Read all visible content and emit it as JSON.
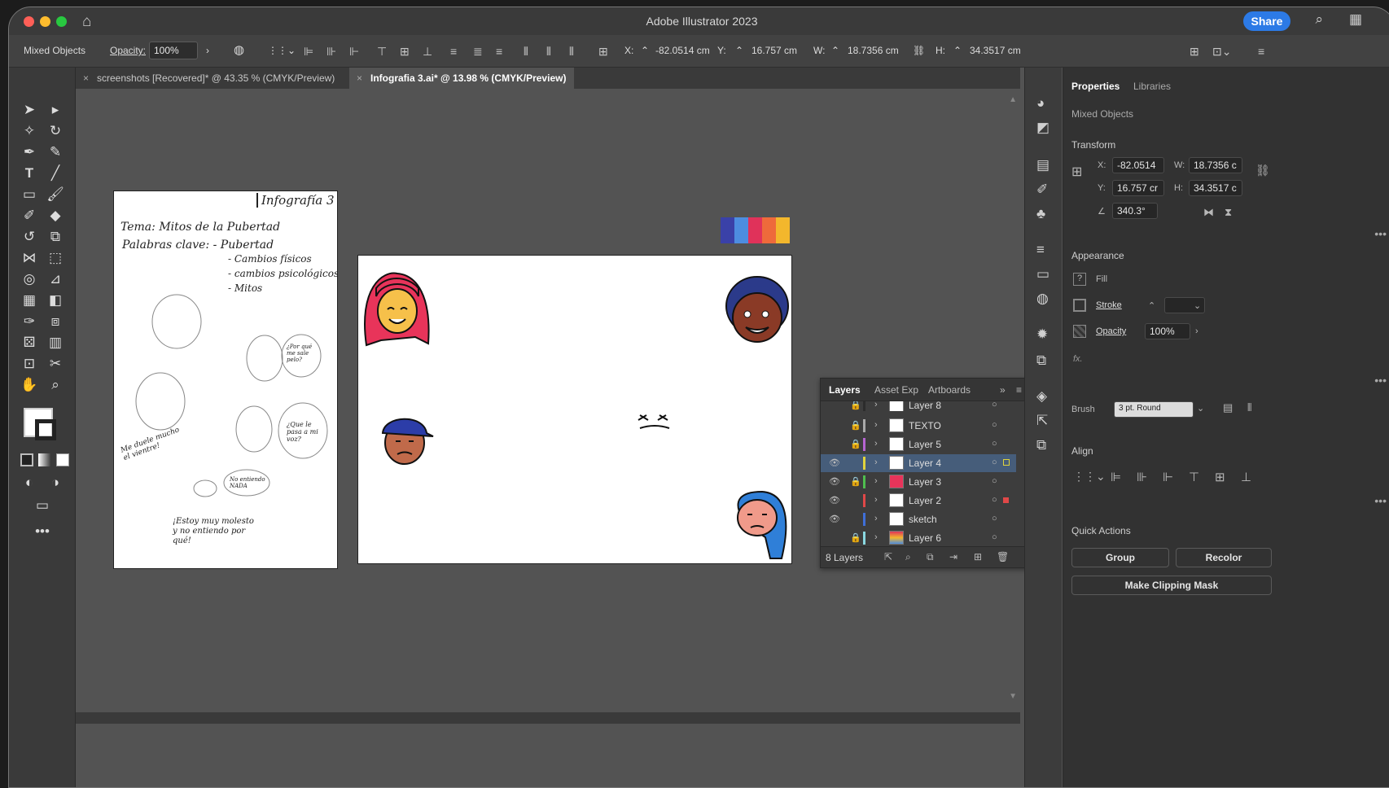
{
  "app": {
    "title": "Adobe Illustrator 2023",
    "share_label": "Share"
  },
  "control_bar": {
    "selection_type": "Mixed Objects",
    "opacity_label": "Opacity:",
    "opacity_value": "100%",
    "x_label": "X:",
    "x_value": "-82.0514 cm",
    "y_label": "Y:",
    "y_value": "16.757 cm",
    "w_label": "W:",
    "w_value": "18.7356 cm",
    "h_label": "H:",
    "h_value": "34.3517 cm"
  },
  "tabs": [
    {
      "label": "screenshots [Recovered]* @ 43.35 % (CMYK/Preview)",
      "active": false
    },
    {
      "label": "Infografia 3.ai* @ 13.98 % (CMYK/Preview)",
      "active": true
    }
  ],
  "sketch": {
    "title": "Infografía 3",
    "line1": "Tema: Mitos de la Pubertad",
    "line2": "Palabras clave: - Pubertad",
    "kw1": "- Cambios físicos",
    "kw2": "- cambios psicológicos",
    "kw3": "- Mitos",
    "bubble1": "¿Por qué me sale pelo?",
    "bubble2": "¿Que le pasa a mi voz?",
    "bubble3": "No entiendo NADA",
    "note1": "Me duele mucho el vientre!",
    "note2": "¡Estoy muy molesto y no entiendo por qué!"
  },
  "swatches": [
    "#3a41a8",
    "#4d8de0",
    "#e0325a",
    "#ee6a3b",
    "#f3b72c"
  ],
  "layers_panel": {
    "tabs": [
      "Layers",
      "Asset Exp",
      "Artboards"
    ],
    "rows": [
      {
        "name": "Layer 8",
        "visible": false,
        "locked": true,
        "color": "#2c2c2c"
      },
      {
        "name": "TEXTO",
        "visible": false,
        "locked": true,
        "color": "#aaaaaa"
      },
      {
        "name": "Layer 5",
        "visible": false,
        "locked": true,
        "color": "#b564d1"
      },
      {
        "name": "Layer 4",
        "visible": true,
        "locked": false,
        "color": "#e0d33d",
        "selected": true
      },
      {
        "name": "Layer 3",
        "visible": true,
        "locked": true,
        "color": "#4fbe4f"
      },
      {
        "name": "Layer 2",
        "visible": true,
        "locked": false,
        "color": "#e04848"
      },
      {
        "name": "sketch",
        "visible": true,
        "locked": false,
        "color": "#3f6fd8"
      },
      {
        "name": "Layer 6",
        "visible": false,
        "locked": true,
        "color": "#8ad8e0"
      }
    ],
    "count_label": "8 Layers"
  },
  "properties": {
    "tabs": [
      "Properties",
      "Libraries"
    ],
    "selection": "Mixed Objects",
    "transform_title": "Transform",
    "x": "-82.0514",
    "w": "18.7356 c",
    "y": "16.757 cr",
    "h": "34.3517 c",
    "rotation": "340.3°",
    "appearance_title": "Appearance",
    "fill_label": "Fill",
    "stroke_label": "Stroke",
    "opacity_label": "Opacity",
    "opacity_value": "100%",
    "fx": "fx.",
    "brush_label": "Brush",
    "brush_value": "3 pt. Round",
    "align_title": "Align",
    "quick_actions_title": "Quick Actions",
    "group_label": "Group",
    "recolor_label": "Recolor",
    "mask_label": "Make Clipping Mask"
  }
}
